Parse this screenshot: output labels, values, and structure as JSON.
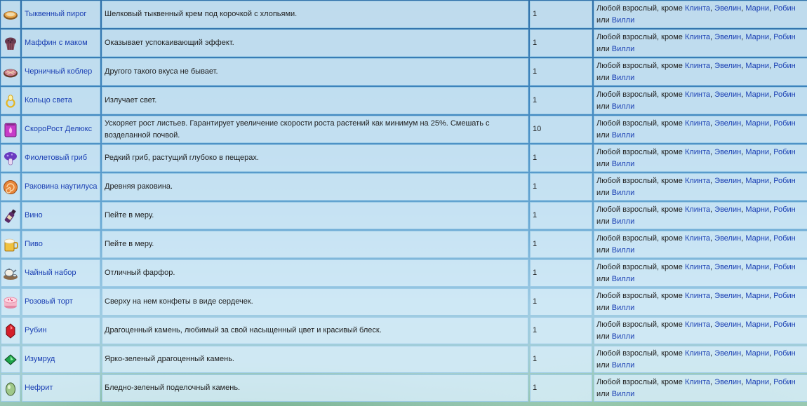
{
  "gifts": [
    {
      "icon": "pumpkin-pie-icon",
      "name": "Тыквенный пирог",
      "desc": "Шелковый тыквенный крем под корочкой с хлопьями.",
      "qty": "1"
    },
    {
      "icon": "poppy-muffin-icon",
      "name": "Маффин с маком",
      "desc": "Оказывает успокаивающий эффект.",
      "qty": "1"
    },
    {
      "icon": "blueberry-cobbler-icon",
      "name": "Черничный коблер",
      "desc": "Другого такого вкуса не бывает.",
      "qty": "1"
    },
    {
      "icon": "ring-of-light-icon",
      "name": "Кольцо света",
      "desc": "Излучает свет.",
      "qty": "1"
    },
    {
      "icon": "deluxe-speed-gro-icon",
      "name": "СкороРост Делюкс",
      "desc": "Ускоряет рост листьев. Гарантирует увеличение скорости роста растений как минимум на 25%. Смешать с возделанной почвой.",
      "qty": "10"
    },
    {
      "icon": "purple-mushroom-icon",
      "name": "Фиолетовый гриб",
      "desc": "Редкий гриб, растущий глубоко в пещерах.",
      "qty": "1"
    },
    {
      "icon": "nautilus-shell-icon",
      "name": "Раковина наутилуса",
      "desc": "Древняя раковина.",
      "qty": "1"
    },
    {
      "icon": "wine-bottle-icon",
      "name": "Вино",
      "desc": "Пейте в меру.",
      "qty": "1"
    },
    {
      "icon": "beer-mug-icon",
      "name": "Пиво",
      "desc": "Пейте в меру.",
      "qty": "1"
    },
    {
      "icon": "tea-set-icon",
      "name": "Чайный набор",
      "desc": "Отличный фарфор.",
      "qty": "1"
    },
    {
      "icon": "pink-cake-icon",
      "name": "Розовый торт",
      "desc": "Сверху на нем конфеты в виде сердечек.",
      "qty": "1"
    },
    {
      "icon": "ruby-icon",
      "name": "Рубин",
      "desc": "Драгоценный камень, любимый за свой насыщенный цвет и красивый блеск.",
      "qty": "1"
    },
    {
      "icon": "emerald-icon",
      "name": "Изумруд",
      "desc": "Ярко-зеленый драгоценный камень.",
      "qty": "1"
    },
    {
      "icon": "jade-icon",
      "name": "Нефрит",
      "desc": "Бледно-зеленый поделочный камень.",
      "qty": "1"
    }
  ],
  "recipients": {
    "prefix": "Любой взрослый, кроме ",
    "c1": "Клинта",
    "s1": ", ",
    "c2": "Эвелин",
    "s2": ", ",
    "c3": "Марни",
    "s3": ", ",
    "c4": "Робин",
    "s4": " или ",
    "c5": "Вилли"
  },
  "colors": {
    "link": "#1a3fb3",
    "cell_border": "#9ccbe6",
    "cell_bg": "#d6ecf8"
  }
}
